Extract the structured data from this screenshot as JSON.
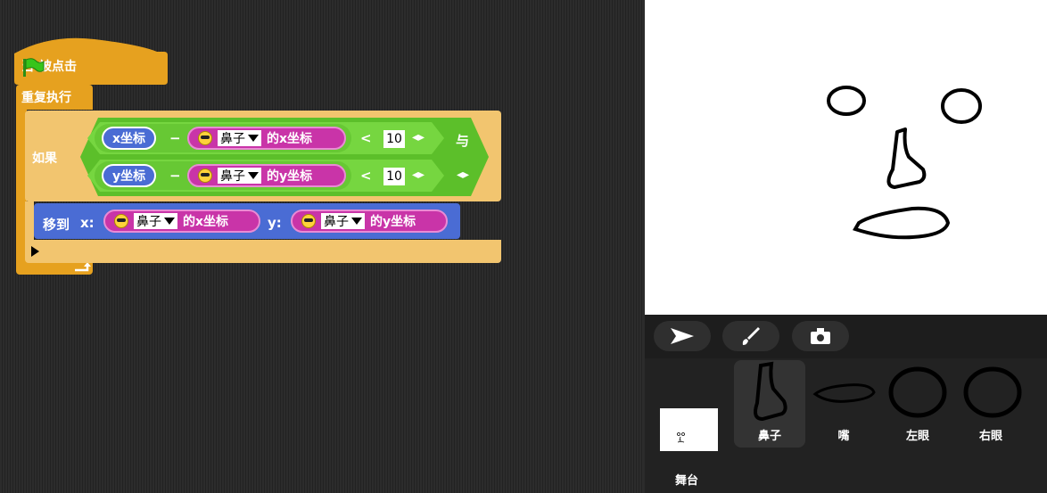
{
  "script": {
    "hat": {
      "label_before": "当",
      "label_after": "被点击"
    },
    "forever": {
      "label": "重复执行"
    },
    "if": {
      "label": "如果"
    },
    "condition1": {
      "var": "x坐标",
      "minus": "−",
      "sprite": "鼻子",
      "prop": "的x坐标",
      "op": "<",
      "value": "10",
      "arrows": "◂▸"
    },
    "condition2": {
      "var": "y坐标",
      "minus": "−",
      "sprite": "鼻子",
      "prop": "的y坐标",
      "op": "<",
      "value": "10",
      "arrows": "◂▸"
    },
    "and_label": "与",
    "goto": {
      "label": "移到",
      "x_label": "x:",
      "x_sprite": "鼻子",
      "x_prop": "的x坐标",
      "y_label": "y:",
      "y_sprite": "鼻子",
      "y_prop": "的y坐标"
    }
  },
  "corral": {
    "stage_label": "舞台",
    "sprites": [
      {
        "name": "鼻子",
        "icon": "nose-drawing",
        "selected": true
      },
      {
        "name": "嘴",
        "icon": "mouth-drawing",
        "selected": false
      },
      {
        "name": "左眼",
        "icon": "eye-circle",
        "selected": false
      },
      {
        "name": "右眼",
        "icon": "eye-circle",
        "selected": false
      }
    ]
  },
  "colors": {
    "control": "#e6a11f",
    "operator": "#5cbf2a",
    "motion": "#4a6cd4",
    "sensing": "#c934a8"
  }
}
